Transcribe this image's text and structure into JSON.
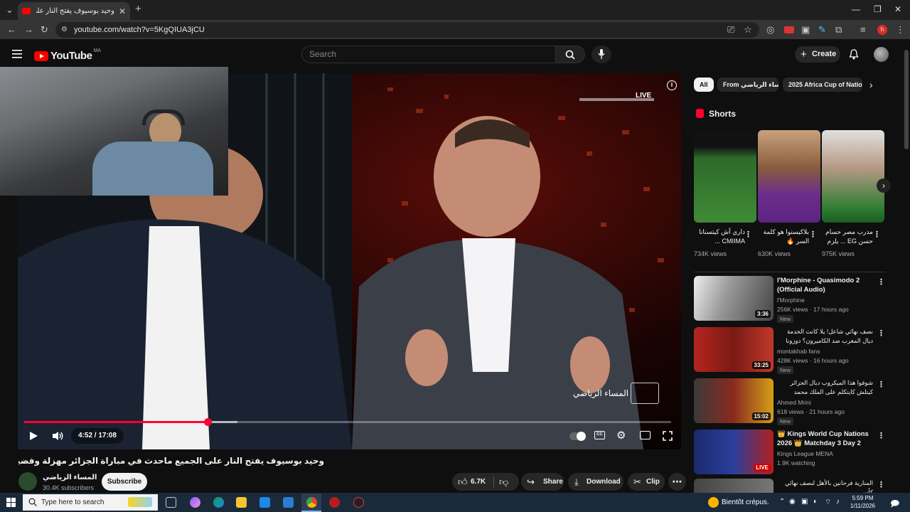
{
  "browser": {
    "tab_title": "وحيد بوسيوف يفتح النار على",
    "url": "youtube.com/watch?v=5KgQIUA3jCU"
  },
  "header": {
    "logo_text": "YouTube",
    "country_code": "MA",
    "search_placeholder": "Search",
    "create_label": "Create"
  },
  "player": {
    "live_badge": "LIVE",
    "time_display": "4:52 / 17:08",
    "progress_fraction": 0.284,
    "buffered_fraction": 0.33,
    "watermark": "المساء الرياضي"
  },
  "video": {
    "title": "وحيد بوسيوف يفتح النار على الجميع ماحدث في مباراة الجزائر مهزلة وفضيحة واعتراض بدر الدين",
    "channel_name": "المساء الرياضي",
    "subscribers": "30.4K subscribers",
    "subscribe_label": "Subscribe",
    "likes": "6.7K",
    "share_label": "Share",
    "download_label": "Download",
    "clip_label": "Clip"
  },
  "sidebar": {
    "chips": [
      "All",
      "From المساء الرياضي",
      "2025 Africa Cup of Natio"
    ],
    "shorts_title": "Shorts",
    "shorts": [
      {
        "title": "داري آش كيتسنانا CMIIMA ...",
        "views": "734K views"
      },
      {
        "title": "بلاكيستوا هو كلمة السر 🔥",
        "views": "630K views"
      },
      {
        "title": "مدرب مصر حسام حسن EG ... يلزم",
        "views": "975K views"
      }
    ],
    "recommended": [
      {
        "title": "l'Morphine - Quasimodo 2 (Official Audio)",
        "channel": "l'Morphine",
        "meta": "256K views · 17 hours ago",
        "badge": "New",
        "duration": "3:36"
      },
      {
        "title": "نصف نهائي شاعل! يلا كانت الخدمة ديال المغرب ضد الكاميرون؟ دوزونا العيدال؟",
        "channel": "montakhab fans",
        "meta": "428K views · 16 hours ago",
        "badge": "New",
        "duration": "33:25"
      },
      {
        "title": "شوفوا هذا الميكروب ديال الجزائر كيتلش كايتكلم على الملك محمد السادس",
        "channel": "Ahmed Mrini",
        "meta": "618 views · 21 hours ago",
        "badge": "New",
        "duration": "15:02"
      },
      {
        "title": "👑 Kings World Cup Nations 2026 👑 Matchday 3 Day 2",
        "channel": "Kings League MENA",
        "meta": "1.9K watching",
        "badge": "",
        "duration": "LIVE"
      },
      {
        "title": "المنارية فرحانين بالأهل لنصف نهائي كأس",
        "channel": "",
        "meta": "",
        "badge": "",
        "duration": ""
      }
    ]
  },
  "taskbar": {
    "search_placeholder": "Type here to search",
    "weather": "Bientôt crépus.",
    "time": "5:59 PM",
    "date": "1/11/2026"
  }
}
